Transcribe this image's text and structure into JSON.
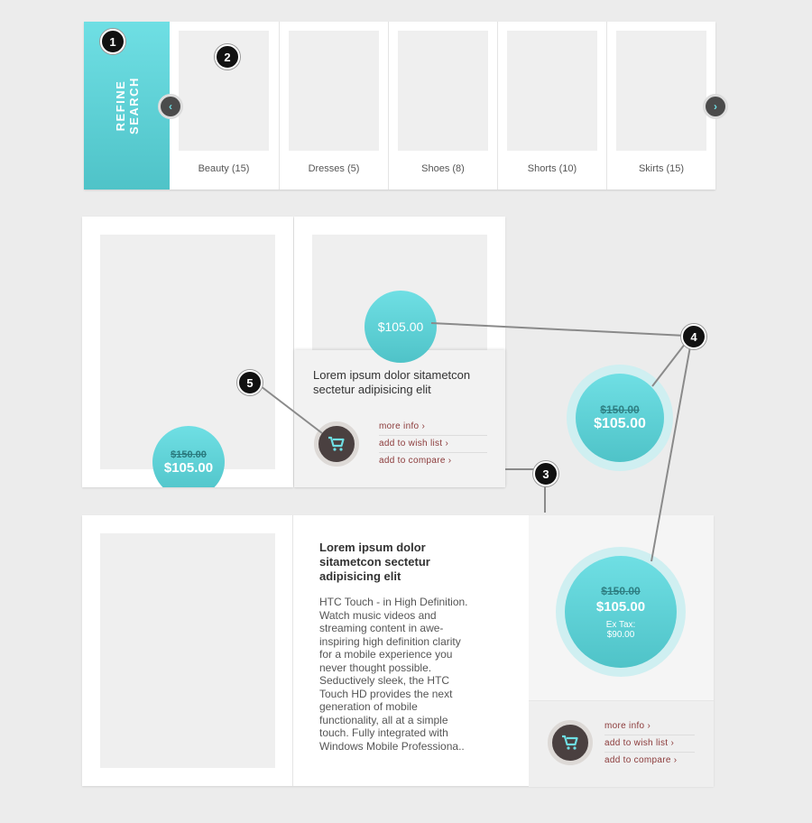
{
  "refine": {
    "line1": "REFINE",
    "line2": "SEARCH"
  },
  "categories": [
    {
      "label": "Beauty (15)"
    },
    {
      "label": "Dresses (5)"
    },
    {
      "label": "Shoes (8)"
    },
    {
      "label": "Shorts (10)"
    },
    {
      "label": "Skirts (15)"
    }
  ],
  "markers": [
    "1",
    "2",
    "3",
    "4",
    "5"
  ],
  "grid": {
    "card1": {
      "old_price": "$150.00",
      "new_price": "$105.00"
    },
    "card2": {
      "price": "$105.00",
      "title": "Lorem ipsum dolor sitametcon sectetur adipisicing elit",
      "links": [
        "more info",
        "add to wish list",
        "add to compare"
      ]
    },
    "sample_price": {
      "old_price": "$150.00",
      "new_price": "$105.00"
    }
  },
  "list": {
    "title": "Lorem ipsum dolor sitametcon sectetur adipisicing elit",
    "body": "HTC Touch - in High Definition. Watch music videos and streaming content in awe-inspiring high definition clarity for a mobile experience you never thought possible. Seductively sleek, the HTC Touch HD provides the next generation of mobile functionality, all at a simple touch. Fully integrated with Windows Mobile Professiona..",
    "old_price": "$150.00",
    "new_price": "$105.00",
    "ex_tax_label": "Ex Tax:",
    "ex_tax_value": "$90.00",
    "links": [
      "more info",
      "add to wish list",
      "add to compare"
    ]
  },
  "colors": {
    "accent": "#5fd3d8",
    "link": "#8b3a3a",
    "cart": "#4a4040"
  }
}
